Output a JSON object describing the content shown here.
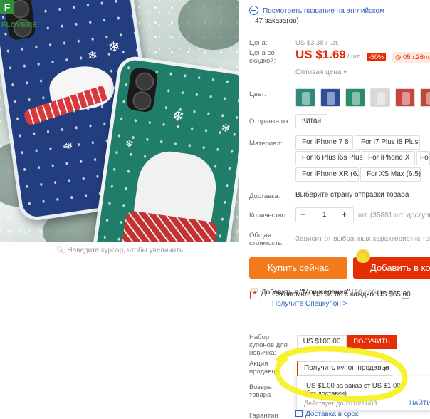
{
  "brand": {
    "logo_text": "FLOVEME",
    "logo_mark": "F"
  },
  "image_zoom_hint": "Наведите курсор, чтобы увеличить",
  "translate_link": "Посмотреть название на английском",
  "orders": "47 заказа(ов)",
  "price": {
    "label": "Цена:",
    "old": "US $3.38 / шт.",
    "discount_label": "Цена со скидкой:",
    "current": "US $1.69",
    "unit": "/ шт.",
    "discount_badge": "-50%",
    "timer": "05h:26m:04",
    "wholesale": "Оптовая цена ▾"
  },
  "color": {
    "label": "Цвет:",
    "swatches": [
      "#2f8a7a",
      "#2c4f9a",
      "#2a8c66",
      "#d8d8d8",
      "#c8443e",
      "#b84a3a"
    ]
  },
  "ship_from": {
    "label": "Отправка из:",
    "value": "Китай"
  },
  "material": {
    "label": "Материал:",
    "options": [
      "For iPhone 7 8",
      "For i7 Plus i8 Plus",
      "For i6 Plus i6s Plus",
      "For iPhone X",
      "For iPhone XR (6.1)",
      "For XS Max (6.5)",
      "Fo"
    ]
  },
  "delivery": {
    "label": "Доставка:",
    "value": "Выберите страну отправки товара"
  },
  "quantity": {
    "label": "Количество:",
    "value": "1",
    "minus": "−",
    "plus": "+",
    "note": "шт. (35881 шт. доступно)"
  },
  "total": {
    "label": "Общая стоимость:",
    "value": "Зависит от выбранных характеристик товара"
  },
  "buttons": {
    "buy_now": "Купить сейчас",
    "add_to_cart": "Добавить в корзину"
  },
  "wishlist": {
    "label": "Добавить в \"Мои желания\"",
    "count": "(16 добавили)"
  },
  "promo": {
    "save_text": "Сэкономьте US $6.00 с каждых US $65.00",
    "coupon_link": "Получите Спецкупон >"
  },
  "newbie_coupon": {
    "label": "Набор купонов для новичка:",
    "amount": "US $100.00",
    "button": "ПОЛУЧИТЬ"
  },
  "seller_coupon": {
    "label": "Акция продавца:",
    "select": "Получить купон продавца"
  },
  "coupon_popup": {
    "line1": "-US $1.00 за заказ от US $1.00",
    "line2": "(без доставки)",
    "valid": "Действует до 2018/11/03",
    "take": "НАЙТИ"
  },
  "returns": {
    "label": "Возврат товара"
  },
  "guarantee": {
    "label": "Гарантии",
    "value": "Доставка в срок"
  }
}
